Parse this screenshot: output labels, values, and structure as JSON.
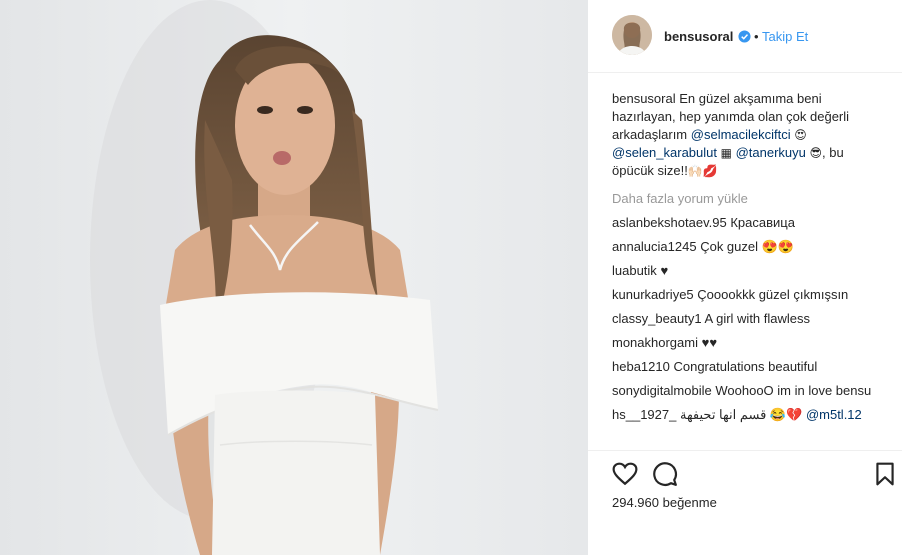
{
  "header": {
    "username": "bensusoral",
    "separator": "•",
    "follow_label": "Takip Et"
  },
  "caption": {
    "username": "bensusoral",
    "text1": "En güzel akşamıma beni hazırlayan, hep yanımda olan çok değerli arkadaşlarım",
    "mention1": "@selmacilekciftci",
    "emoji1": "😍",
    "mention2": "@selen_karabulut",
    "emoji2": "▦",
    "mention3": "@tanerkuyu",
    "emoji3": "😎",
    "text2": ", bu öpücük size!!",
    "emoji4": "🙌🏻💋"
  },
  "load_more": "Daha fazla yorum yükle",
  "comments": [
    {
      "user": "aslanbekshotaev.95",
      "text": "Красавица"
    },
    {
      "user": "annalucia1245",
      "text": "Çok guzel 😍😍"
    },
    {
      "user": "luabutik",
      "text": "♥"
    },
    {
      "user": "kunurkadriye5",
      "text": "Çooookkk güzel çıkmışsın"
    },
    {
      "user": "classy_beauty1",
      "text": "A girl with flawless"
    },
    {
      "user": "monakhorgami",
      "text": "♥♥"
    },
    {
      "user": "heba1210",
      "text": "Congratulations beautiful"
    },
    {
      "user": "sonydigitalmobile",
      "text": "WoohooO im in love bensu"
    },
    {
      "user": "hs__1927_",
      "text": "قسم انها تحيفهة 😂💔",
      "mention": "@m5tl.12"
    }
  ],
  "likes": "294.960 beğenme",
  "icons": {
    "like": "heart-icon",
    "comment": "comment-icon",
    "save": "bookmark-icon",
    "verified": "verified-badge-icon"
  },
  "colors": {
    "link": "#3897f0",
    "mention": "#003569",
    "muted": "#999999",
    "text": "#262626"
  }
}
